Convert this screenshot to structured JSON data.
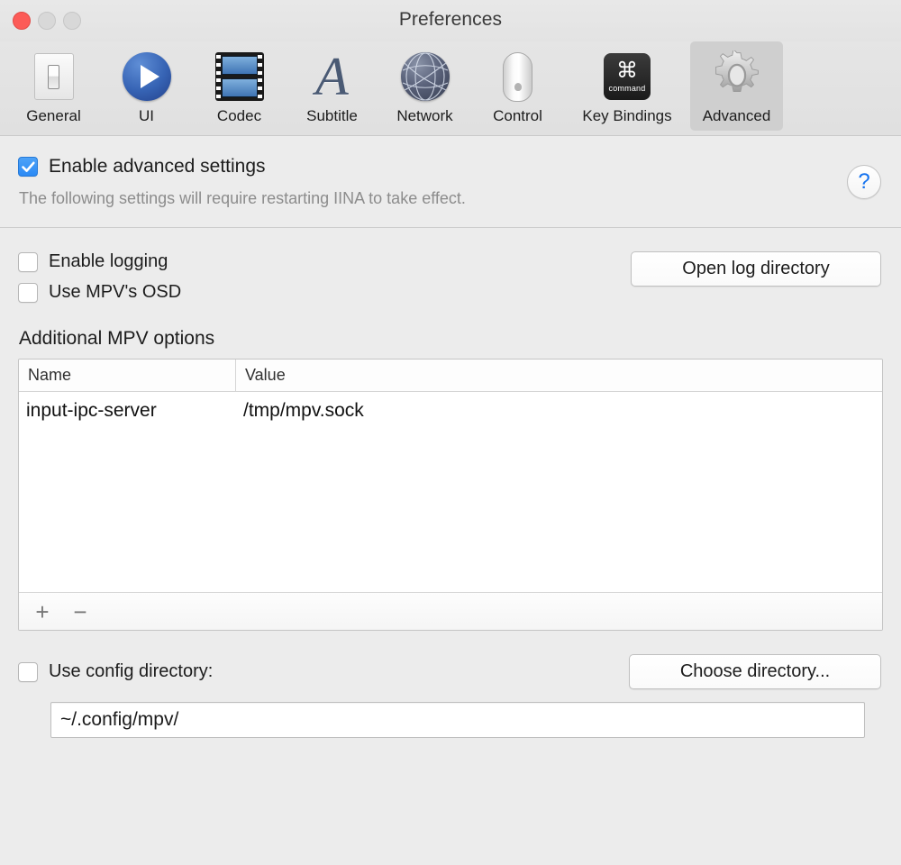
{
  "window": {
    "title": "Preferences",
    "traffic_lights": [
      "close-button",
      "minimize-button",
      "zoom-button"
    ]
  },
  "toolbar": {
    "items": [
      {
        "label": "General",
        "icon": "toggle-switch-icon"
      },
      {
        "label": "UI",
        "icon": "play-circle-icon"
      },
      {
        "label": "Codec",
        "icon": "film-strip-icon"
      },
      {
        "label": "Subtitle",
        "icon": "letter-a-icon"
      },
      {
        "label": "Network",
        "icon": "globe-icon"
      },
      {
        "label": "Control",
        "icon": "mouse-icon"
      },
      {
        "label": "Key Bindings",
        "icon": "command-key-icon"
      },
      {
        "label": "Advanced",
        "icon": "gear-icon"
      }
    ],
    "selected": "Advanced"
  },
  "advanced": {
    "enable_advanced_label": "Enable advanced settings",
    "enable_advanced_checked": true,
    "hint": "The following settings will require restarting IINA to take effect.",
    "help_glyph": "?"
  },
  "options": {
    "enable_logging_label": "Enable logging",
    "enable_logging_checked": false,
    "use_mpv_osd_label": "Use MPV's OSD",
    "use_mpv_osd_checked": false,
    "open_log_directory_label": "Open log directory"
  },
  "mpv_table": {
    "section_title": "Additional MPV options",
    "columns": [
      "Name",
      "Value"
    ],
    "rows": [
      {
        "name": "input-ipc-server",
        "value": "/tmp/mpv.sock"
      }
    ],
    "add_glyph": "+",
    "remove_glyph": "−"
  },
  "config_dir": {
    "use_config_directory_label": "Use config directory:",
    "use_config_directory_checked": false,
    "choose_directory_label": "Choose directory...",
    "path_value": "~/.config/mpv/",
    "path_placeholder": "~/.config/mpv/"
  },
  "colors": {
    "accent_blue": "#2b8af5",
    "help_blue": "#1573ef",
    "close_red": "#fc5b57",
    "window_bg": "#ececec",
    "toolbar_selected": "#cfcfcf"
  }
}
